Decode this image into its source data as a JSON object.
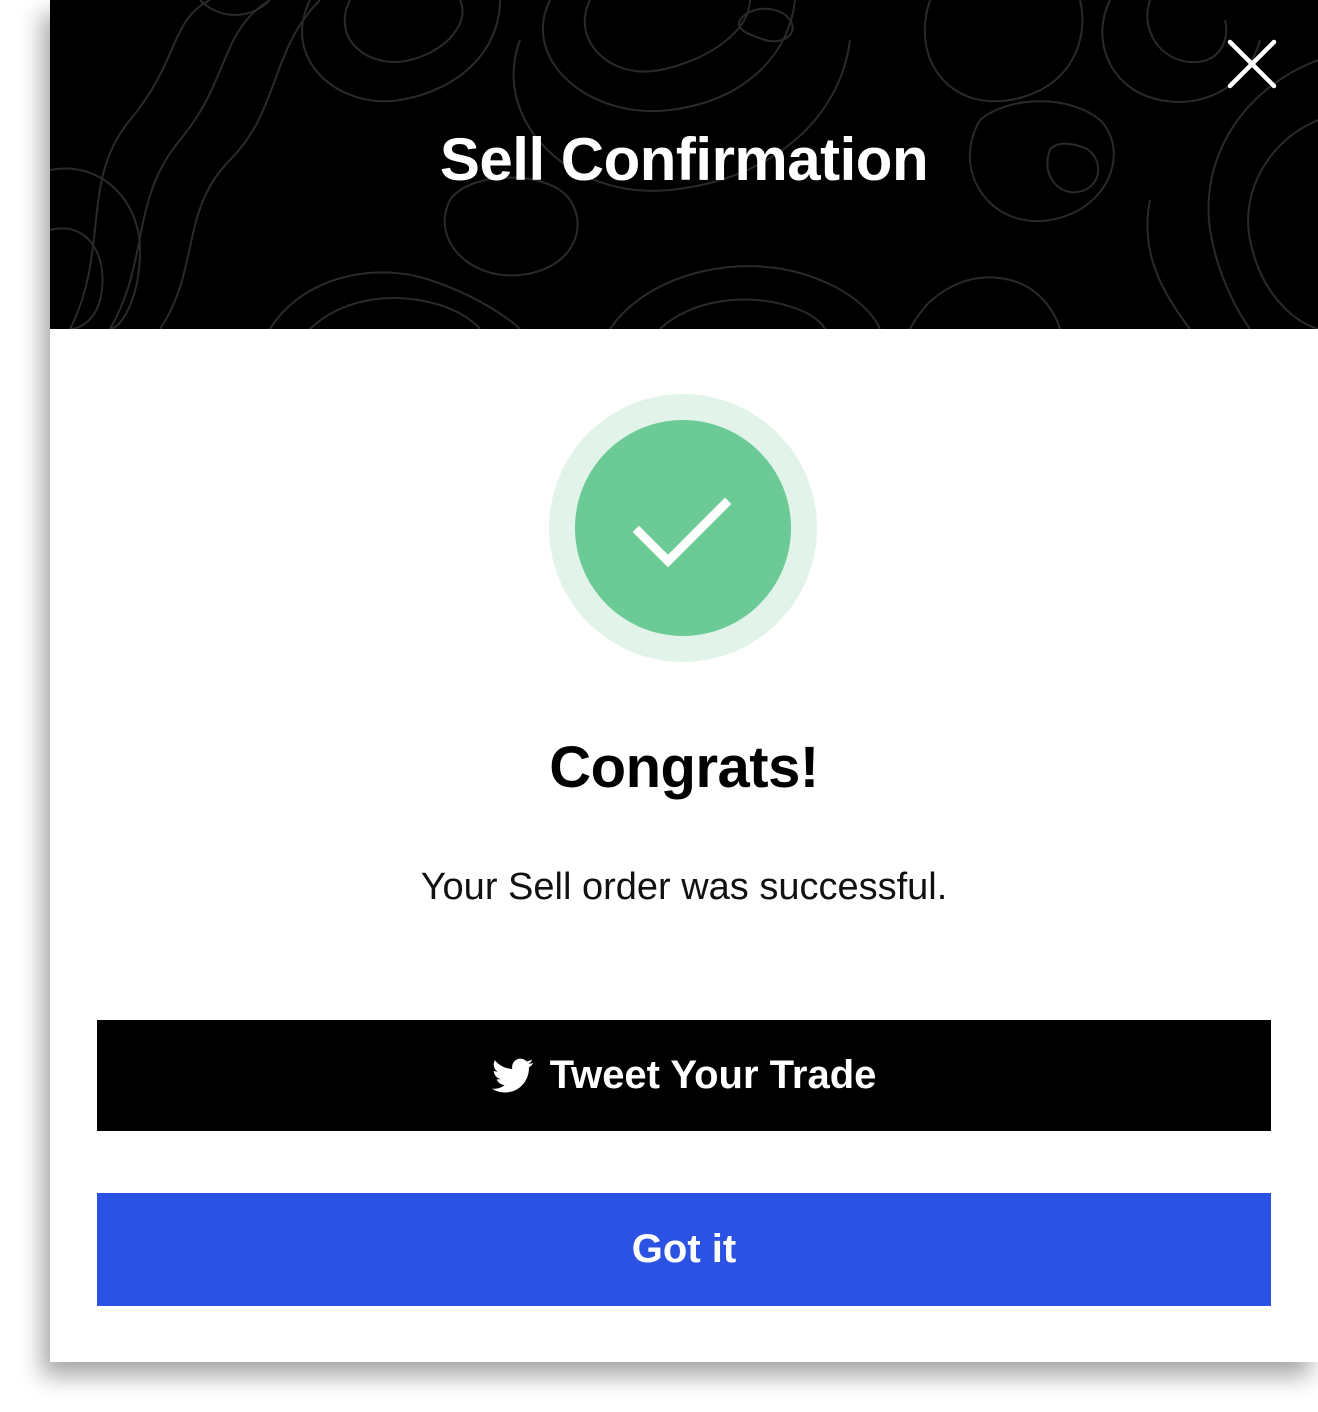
{
  "dialog": {
    "title": "Sell Confirmation",
    "close_icon": "close-icon",
    "success_icon": "checkmark-icon",
    "heading": "Congrats!",
    "message": "Your Sell order was successful.",
    "tweet_button_label": "Tweet Your Trade",
    "tweet_button_icon": "twitter-icon",
    "confirm_button_label": "Got it"
  },
  "colors": {
    "header_background": "#000000",
    "success_green": "#6bca95",
    "success_ring": "#e2f4ea",
    "primary_blue": "#2b52e3",
    "tweet_button": "#000000"
  }
}
